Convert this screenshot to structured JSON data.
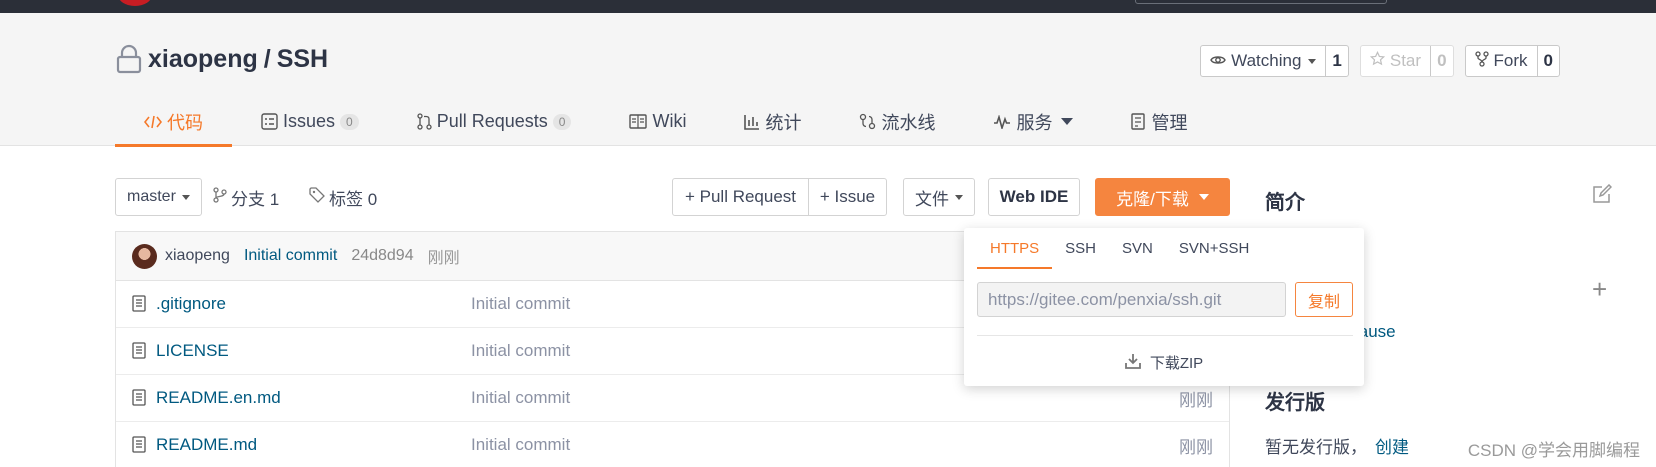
{
  "repo": {
    "owner": "xiaopeng",
    "separator": "/",
    "name": "SSH"
  },
  "actions": {
    "watch_label": "Watching",
    "watch_count": "1",
    "star_label": "Star",
    "star_count": "0",
    "fork_label": "Fork",
    "fork_count": "0"
  },
  "tabs": [
    {
      "label": "代码",
      "icon": "code-icon",
      "active": true
    },
    {
      "label": "Issues",
      "icon": "issues-icon",
      "count": "0"
    },
    {
      "label": "Pull Requests",
      "icon": "pull-request-icon",
      "count": "0"
    },
    {
      "label": "Wiki",
      "icon": "wiki-icon"
    },
    {
      "label": "统计",
      "icon": "stats-icon"
    },
    {
      "label": "流水线",
      "icon": "pipeline-icon"
    },
    {
      "label": "服务",
      "icon": "service-icon",
      "dropdown": true
    },
    {
      "label": "管理",
      "icon": "manage-icon"
    }
  ],
  "toolbar": {
    "branch": "master",
    "branches_label": "分支 1",
    "tags_label": "标签 0",
    "pull_request_button": "+ Pull Request",
    "issue_button": "+ Issue",
    "file_button": "文件",
    "webide_button": "Web IDE",
    "clone_button": "克隆/下载"
  },
  "commit": {
    "author": "xiaopeng",
    "message": "Initial commit",
    "sha": "24d8d94",
    "time": "刚刚"
  },
  "files": [
    {
      "name": ".gitignore",
      "message": "Initial commit",
      "time": ""
    },
    {
      "name": "LICENSE",
      "message": "Initial commit",
      "time": ""
    },
    {
      "name": "README.en.md",
      "message": "Initial commit",
      "time": "刚刚"
    },
    {
      "name": "README.md",
      "message": "Initial commit",
      "time": "刚刚"
    }
  ],
  "sidebar": {
    "intro_title": "简介",
    "license_fragment": "lause",
    "release_title": "发行版",
    "release_text": "暂无发行版，",
    "release_link": "创建"
  },
  "clone_popover": {
    "tabs": [
      "HTTPS",
      "SSH",
      "SVN",
      "SVN+SSH"
    ],
    "active_tab": "HTTPS",
    "url": "https://gitee.com/penxia/ssh.git",
    "copy_button": "复制",
    "download_zip": "下载ZIP"
  },
  "watermark": "CSDN @学会用脚编程",
  "colors": {
    "accent": "#f5792a",
    "clone_button": "#f5853f",
    "link": "#005980",
    "topbar": "#2b2f38"
  }
}
